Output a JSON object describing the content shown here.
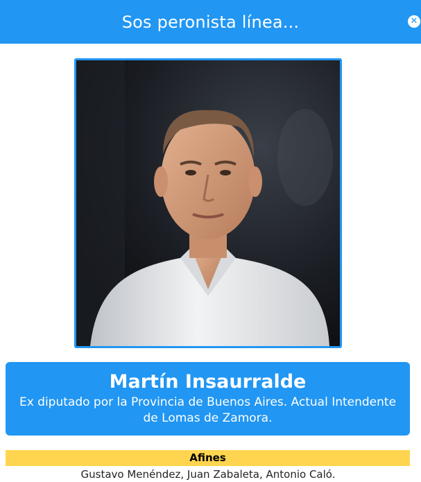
{
  "header": {
    "title": "Sos peronista línea...",
    "close_icon": "close-icon"
  },
  "profile": {
    "photo": "portrait-photo",
    "name": "Martín Insaurralde",
    "description": "Ex diputado por la Provincia de Buenos Aires. Actual Intendente de Lomas de Zamora."
  },
  "afines": {
    "heading": "Afines",
    "names": "Gustavo Menéndez, Juan Zabaleta, Antonio Caló."
  },
  "colors": {
    "accent": "#2196f3",
    "highlight": "#ffd54f",
    "background": "#ffffff"
  }
}
